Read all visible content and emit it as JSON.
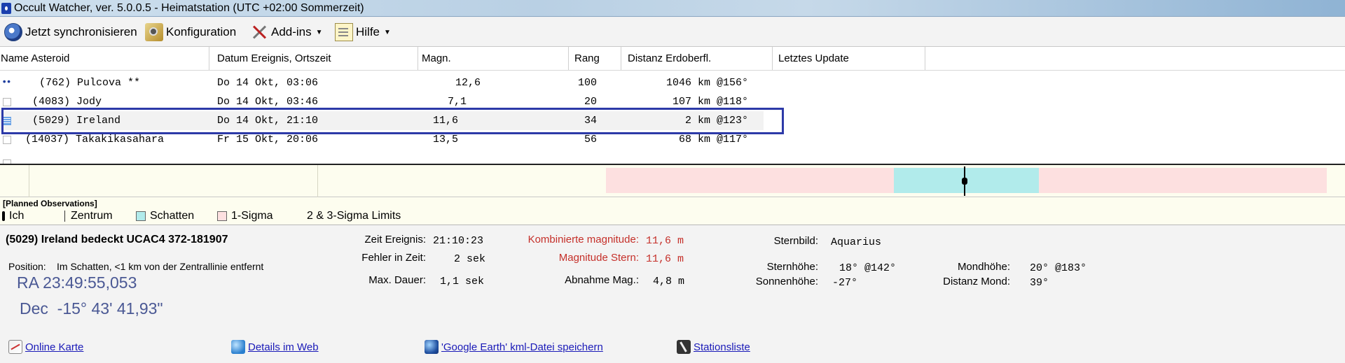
{
  "window": {
    "title": "Occult Watcher, ver. 5.0.0.5 - Heimatstation (UTC +02:00 Sommerzeit)"
  },
  "menu": [
    {
      "label": "Jetzt synchronisieren",
      "icon": "sync-icon"
    },
    {
      "label": "Konfiguration",
      "icon": "config-icon"
    },
    {
      "label": "Add-ins",
      "icon": "tools-icon",
      "dropdown": true
    },
    {
      "label": "Hilfe",
      "icon": "help-icon",
      "dropdown": true
    }
  ],
  "table": {
    "columns": [
      "Name Asteroid",
      "Datum Ereignis, Ortszeit",
      "Magn.",
      "Rang",
      "Distanz Erdoberfl.",
      "Letztes Update"
    ],
    "rows": [
      {
        "marker": "••",
        "name": "(762) Pulcova **",
        "date": "Do 14 Okt, 03:06",
        "mag": "12,6",
        "rank": "100",
        "dist": "1046 km @156°"
      },
      {
        "marker": "",
        "name": "(4083) Jody",
        "date": "Do 14 Okt, 03:46",
        "mag": "7,1",
        "rank": "20",
        "dist": "107 km @118°"
      },
      {
        "marker": "",
        "name": "(5029) Ireland",
        "date": "Do 14 Okt, 21:10",
        "mag": "11,6",
        "rank": "34",
        "dist": "2 km @123°",
        "selected": true
      },
      {
        "marker": "",
        "name": "(14037) Takakikasahara",
        "date": "Fr 15 Okt, 20:06",
        "mag": "13,5",
        "rank": "56",
        "dist": "68 km @117°"
      }
    ]
  },
  "timeline": {
    "colors": {
      "sigma": "#fde0e0",
      "shadow": "#b1ebeb",
      "background": "#fdfdef"
    }
  },
  "legend": {
    "title": "[Planned Observations]",
    "items": [
      "Ich",
      "Zentrum",
      "Schatten",
      "1-Sigma",
      "2 & 3-Sigma Limits"
    ]
  },
  "details": {
    "heading": "(5029) Ireland bedeckt UCAC4 372-181907",
    "position_label": "Position:",
    "position_text": "Im Schatten, <1 km von der Zentrallinie entfernt",
    "ra": "RA 23:49:55,053",
    "dec": "Dec  -15° 43' 41,93\"",
    "zeit_label": "Zeit Ereignis:",
    "zeit_value": "21:10:23",
    "fehler_label": "Fehler in Zeit:",
    "fehler_value": "2 sek",
    "dauer_label": "Max. Dauer:",
    "dauer_value": "1,1 sek",
    "kombi_label": "Kombinierte magnitude:",
    "kombi_value": "11,6 m",
    "magstern_label": "Magnitude Stern:",
    "magstern_value": "11,6 m",
    "abnahme_label": "Abnahme Mag.:",
    "abnahme_value": "4,8 m",
    "sternbild_label": "Sternbild:",
    "sternbild_value": "Aquarius",
    "sternhoehe_label": "Sternhöhe:",
    "sternhoehe_value": "18° @142°",
    "sonnenhoehe_label": "Sonnenhöhe:",
    "sonnenhoehe_value": "-27°",
    "mondhoehe_label": "Mondhöhe:",
    "mondhoehe_value": "20° @183°",
    "distmond_label": "Distanz Mond:",
    "distmond_value": "39°",
    "accent_red": "#c5302a"
  },
  "links": [
    {
      "label": "Online Karte",
      "icon": "map-icon"
    },
    {
      "label": "Details im Web",
      "icon": "web-icon"
    },
    {
      "label": "'Google Earth' kml-Datei speichern",
      "icon": "earth-icon"
    },
    {
      "label": "Stationsliste",
      "icon": "station-icon"
    }
  ]
}
